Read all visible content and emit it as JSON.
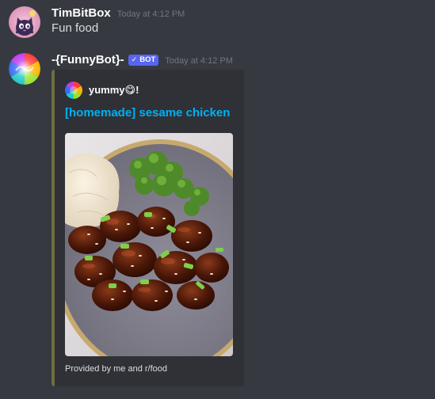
{
  "messages": [
    {
      "username": "TimBitBox",
      "timestamp": "Today at 4:12 PM",
      "content": "Fun food"
    },
    {
      "username": "-{FunnyBot}-",
      "bot_tag": "BOT",
      "bot_tag_check": "✓",
      "timestamp": "Today at 4:12 PM",
      "embed": {
        "author": "yummy😋!",
        "title": "[homemade] sesame chicken",
        "footer": "Provided by me and r/food",
        "border_color": "#6e6e40"
      }
    }
  ],
  "theme": {
    "background": "#36393f",
    "embed_background": "#2f3136",
    "link_color": "#00b0f4",
    "bot_tag_color": "#5865f2"
  },
  "icons": {
    "avatar_1": "cat-avatar-icon",
    "avatar_2": "rainbow-logo-avatar-icon",
    "embed_author_icon": "rainbow-circle-icon",
    "embed_image": "sesame-chicken-photo"
  }
}
